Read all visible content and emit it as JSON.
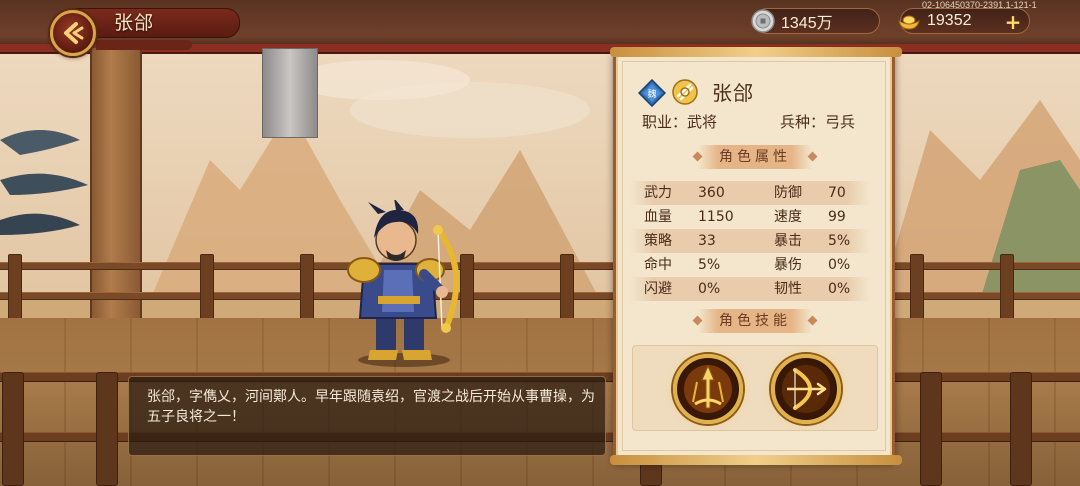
{
  "header": {
    "title": "张郃",
    "back_icon": "back-arrow-icon",
    "build_tag": "02-106450370-2391.1-121-1"
  },
  "currencies": {
    "silver": {
      "icon": "silver-coin-icon",
      "value": "1345万"
    },
    "gold": {
      "icon": "gold-ingot-icon",
      "value": "19352",
      "add_icon": "plus-icon"
    }
  },
  "hero": {
    "name": "张郃",
    "faction_icon": "wei-faction-icon",
    "rank_icon": "rank-emblem-icon",
    "class_label": "职业：",
    "class_value": "武将",
    "troop_label": "兵种：",
    "troop_value": "弓兵",
    "bio": "张郃，字儁乂，河间鄚人。早年跟随袁绍，官渡之战后开始从事曹操，为五子良将之一！"
  },
  "attributes": {
    "header": "角色属性",
    "rows": [
      {
        "l_label": "武力",
        "l_value": "360",
        "r_label": "防御",
        "r_value": "70"
      },
      {
        "l_label": "血量",
        "l_value": "1150",
        "r_label": "速度",
        "r_value": "99"
      },
      {
        "l_label": "策略",
        "l_value": "33",
        "r_label": "暴击",
        "r_value": "5%"
      },
      {
        "l_label": "命中",
        "l_value": "5%",
        "r_label": "暴伤",
        "r_value": "0%"
      },
      {
        "l_label": "闪避",
        "l_value": "0%",
        "r_label": "韧性",
        "r_value": "0%"
      }
    ]
  },
  "skills": {
    "header": "角色技能",
    "items": [
      {
        "icon": "arrow-volley-skill-icon"
      },
      {
        "icon": "drawn-bow-skill-icon"
      }
    ]
  },
  "colors": {
    "panel_bg": "#f3e6cd",
    "panel_border": "#9a5a34",
    "text_brown": "#4a2c1a",
    "gold_accent": "#e2b24a"
  }
}
